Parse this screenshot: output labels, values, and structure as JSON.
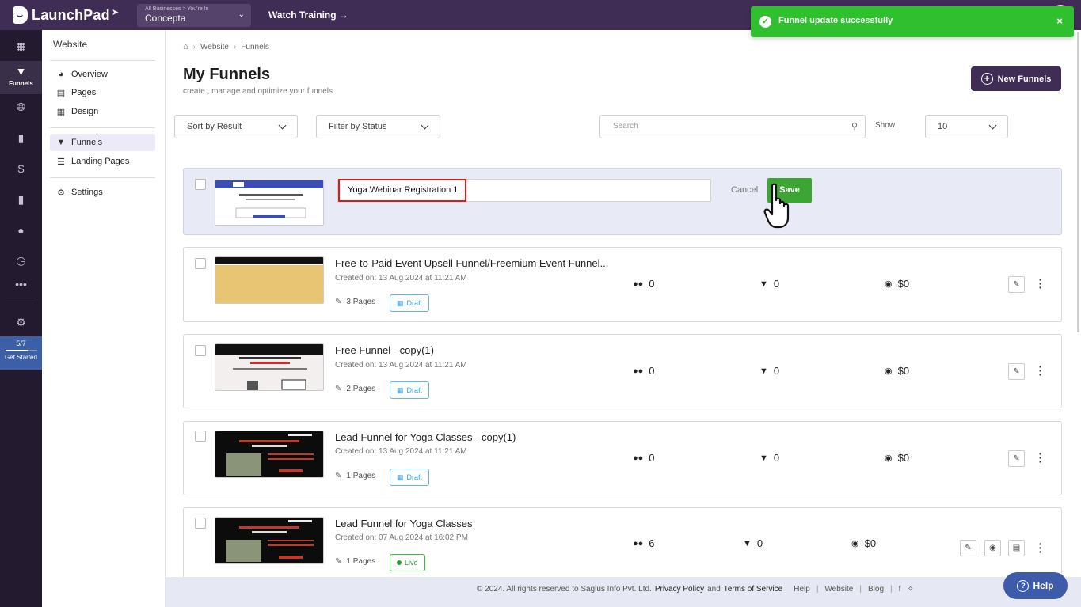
{
  "app": {
    "logo": "LaunchPad",
    "business_small": "All Businesses > You're In",
    "business_name": "Concepta",
    "watch_training": "Watch Training →"
  },
  "toast": {
    "message": "Funnel update successfully",
    "close": "×"
  },
  "rail": {
    "active_label": "Funnels",
    "progress_text": "5/7",
    "progress_fraction": 0.71,
    "get_started": "Get Started"
  },
  "website_menu": {
    "title": "Website",
    "items": [
      {
        "label": "Overview",
        "icon": "gauge-icon"
      },
      {
        "label": "Pages",
        "icon": "pages-icon"
      },
      {
        "label": "Design",
        "icon": "design-icon"
      },
      {
        "label": "Funnels",
        "icon": "funnel-icon"
      },
      {
        "label": "Landing Pages",
        "icon": "landing-pages-icon"
      },
      {
        "label": "Settings",
        "icon": "gear-icon"
      }
    ]
  },
  "breadcrumb": {
    "home": "home-icon",
    "level1": "Website",
    "level2": "Funnels"
  },
  "header": {
    "title": "My Funnels",
    "subtitle": "create , manage and optimize your funnels",
    "new_button": "New Funnels"
  },
  "filters": {
    "sort": "Sort by Result",
    "status": "Filter by Status",
    "search_placeholder": "Search",
    "show_label": "Show",
    "show_value": "10"
  },
  "edit_row": {
    "name_value": "Yoga Webinar Registration 1",
    "cancel": "Cancel",
    "save": "Save"
  },
  "funnels": [
    {
      "name": "Free-to-Paid Event Upsell Funnel/Freemium Event Funnel...",
      "created": "Created on: 13 Aug 2024 at 11:21 AM",
      "pages": "3 Pages",
      "status": "Draft",
      "visitors": "0",
      "conversions": "0",
      "revenue": "$0"
    },
    {
      "name": "Free Funnel - copy(1)",
      "created": "Created on: 13 Aug 2024 at 11:21 AM",
      "pages": "2 Pages",
      "status": "Draft",
      "visitors": "0",
      "conversions": "0",
      "revenue": "$0"
    },
    {
      "name": "Lead Funnel for Yoga Classes - copy(1)",
      "created": "Created on: 13 Aug 2024 at 11:21 AM",
      "pages": "1 Pages",
      "status": "Draft",
      "visitors": "0",
      "conversions": "0",
      "revenue": "$0"
    },
    {
      "name": "Lead Funnel for Yoga Classes",
      "created": "Created on: 07 Aug 2024 at 16:02 PM",
      "pages": "1 Pages",
      "status": "Live",
      "visitors": "6",
      "conversions": "0",
      "revenue": "$0"
    }
  ],
  "footer": {
    "copyright": "©  2024. All rights reserved to Saglus Info Pvt. Ltd.",
    "privacy": "Privacy Policy",
    "and": "and",
    "terms": "Terms of Service",
    "help": "Help",
    "website": "Website",
    "blog": "Blog"
  },
  "help_button": "Help",
  "colors": {
    "brand": "#3f2d56",
    "success": "#2fbf2f",
    "save": "#3da534",
    "draft": "#39a0d8",
    "live": "#2e9c2e"
  }
}
